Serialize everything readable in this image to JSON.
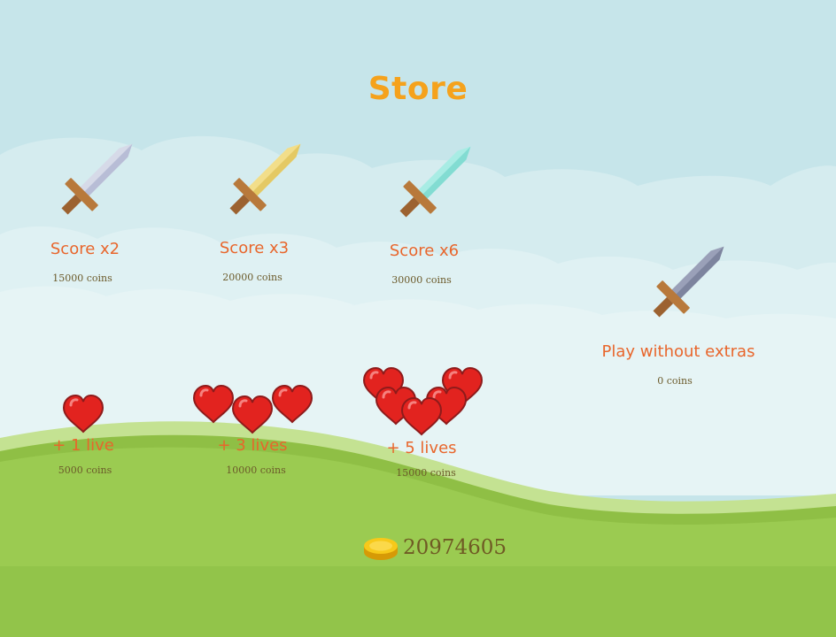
{
  "title": "Store",
  "colors": {
    "title": "#f5a21c",
    "label": "#e8662c",
    "price": "#6b5a2a",
    "sky": "#c6e5ea",
    "grass": "#96c84e",
    "heart": "#e2231f",
    "coin": "#f5c20a"
  },
  "items": {
    "score_x2": {
      "label": "Score x2",
      "price": "15000 coins",
      "icon": "silver-sword-icon"
    },
    "score_x3": {
      "label": "Score x3",
      "price": "20000 coins",
      "icon": "gold-sword-icon"
    },
    "score_x6": {
      "label": "Score x6",
      "price": "30000 coins",
      "icon": "crystal-sword-icon"
    },
    "no_extras": {
      "label": "Play without extras",
      "price": "0 coins",
      "icon": "iron-sword-icon"
    },
    "lives_1": {
      "label": "+ 1 live",
      "price": "5000 coins",
      "icon": "heart-icon"
    },
    "lives_3": {
      "label": "+ 3 lives",
      "price": "10000 coins",
      "icon": "heart-icon"
    },
    "lives_5": {
      "label": "+ 5 lives",
      "price": "15000 coins",
      "icon": "heart-icon"
    }
  },
  "wallet": {
    "coins": "20974605",
    "icon": "coin-icon"
  }
}
